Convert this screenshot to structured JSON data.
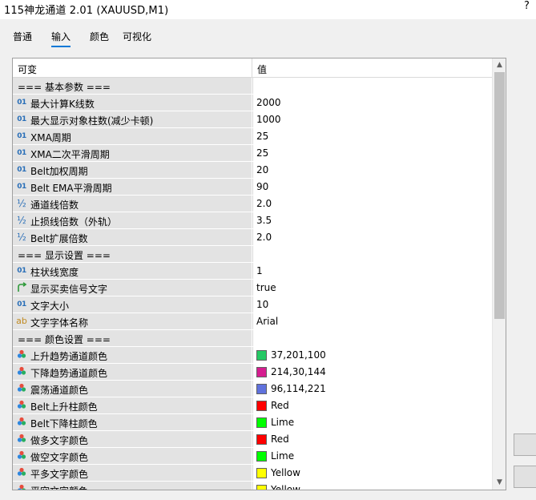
{
  "window": {
    "title": "115神龙通道 2.01 (XAUUSD,M1)",
    "help_glyph": "?"
  },
  "tabs": [
    {
      "label": "普通"
    },
    {
      "label": "输入"
    },
    {
      "label": "颜色"
    },
    {
      "label": "可视化"
    }
  ],
  "active_tab": "输入",
  "grid": {
    "col_variable": "可变",
    "col_value": "值",
    "rows": [
      {
        "type": "group",
        "label": "=== 基本参数 ==="
      },
      {
        "type": "int",
        "icon": "int-icon",
        "label": "最大计算K线数",
        "value": "2000"
      },
      {
        "type": "int",
        "icon": "int-icon",
        "label": "最大显示对象柱数(减少卡顿)",
        "value": "1000"
      },
      {
        "type": "int",
        "icon": "int-icon",
        "label": "XMA周期",
        "value": "25"
      },
      {
        "type": "int",
        "icon": "int-icon",
        "label": "XMA二次平滑周期",
        "value": "25"
      },
      {
        "type": "int",
        "icon": "int-icon",
        "label": "Belt加权周期",
        "value": "20"
      },
      {
        "type": "int",
        "icon": "int-icon",
        "label": "Belt EMA平滑周期",
        "value": "90"
      },
      {
        "type": "double",
        "icon": "double-icon",
        "label": "通道线倍数",
        "value": "2.0"
      },
      {
        "type": "double",
        "icon": "double-icon",
        "label": "止损线倍数（外轨）",
        "value": "3.5"
      },
      {
        "type": "double",
        "icon": "double-icon",
        "label": "Belt扩展倍数",
        "value": "2.0"
      },
      {
        "type": "group",
        "label": "=== 显示设置 ==="
      },
      {
        "type": "int",
        "icon": "int-icon",
        "label": "柱状线宽度",
        "value": "1"
      },
      {
        "type": "bool",
        "icon": "bool-icon",
        "label": "显示买卖信号文字",
        "value": "true"
      },
      {
        "type": "int",
        "icon": "int-icon",
        "label": "文字大小",
        "value": "10"
      },
      {
        "type": "string",
        "icon": "string-icon",
        "label": "文字字体名称",
        "value": "Arial"
      },
      {
        "type": "group",
        "label": "=== 颜色设置 ==="
      },
      {
        "type": "color",
        "icon": "color-icon",
        "label": "上升趋势通道颜色",
        "value": "37,201,100",
        "swatch": "#25c964"
      },
      {
        "type": "color",
        "icon": "color-icon",
        "label": "下降趋势通道颜色",
        "value": "214,30,144",
        "swatch": "#d61e90"
      },
      {
        "type": "color",
        "icon": "color-icon",
        "label": "震荡通道颜色",
        "value": "96,114,221",
        "swatch": "#6072dd"
      },
      {
        "type": "color",
        "icon": "color-icon",
        "label": "Belt上升柱颜色",
        "value": "Red",
        "swatch": "#ff0000"
      },
      {
        "type": "color",
        "icon": "color-icon",
        "label": "Belt下降柱颜色",
        "value": "Lime",
        "swatch": "#00ff00"
      },
      {
        "type": "color",
        "icon": "color-icon",
        "label": "做多文字颜色",
        "value": "Red",
        "swatch": "#ff0000"
      },
      {
        "type": "color",
        "icon": "color-icon",
        "label": "做空文字颜色",
        "value": "Lime",
        "swatch": "#00ff00"
      },
      {
        "type": "color",
        "icon": "color-icon",
        "label": "平多文字颜色",
        "value": "Yellow",
        "swatch": "#ffff00"
      },
      {
        "type": "color",
        "icon": "color-icon",
        "label": "平空文字颜色",
        "value": "Yellow",
        "swatch": "#ffff00"
      }
    ]
  },
  "colors": {
    "accent": "#0078d7",
    "name_cell_bg": "#e3e3e3"
  }
}
